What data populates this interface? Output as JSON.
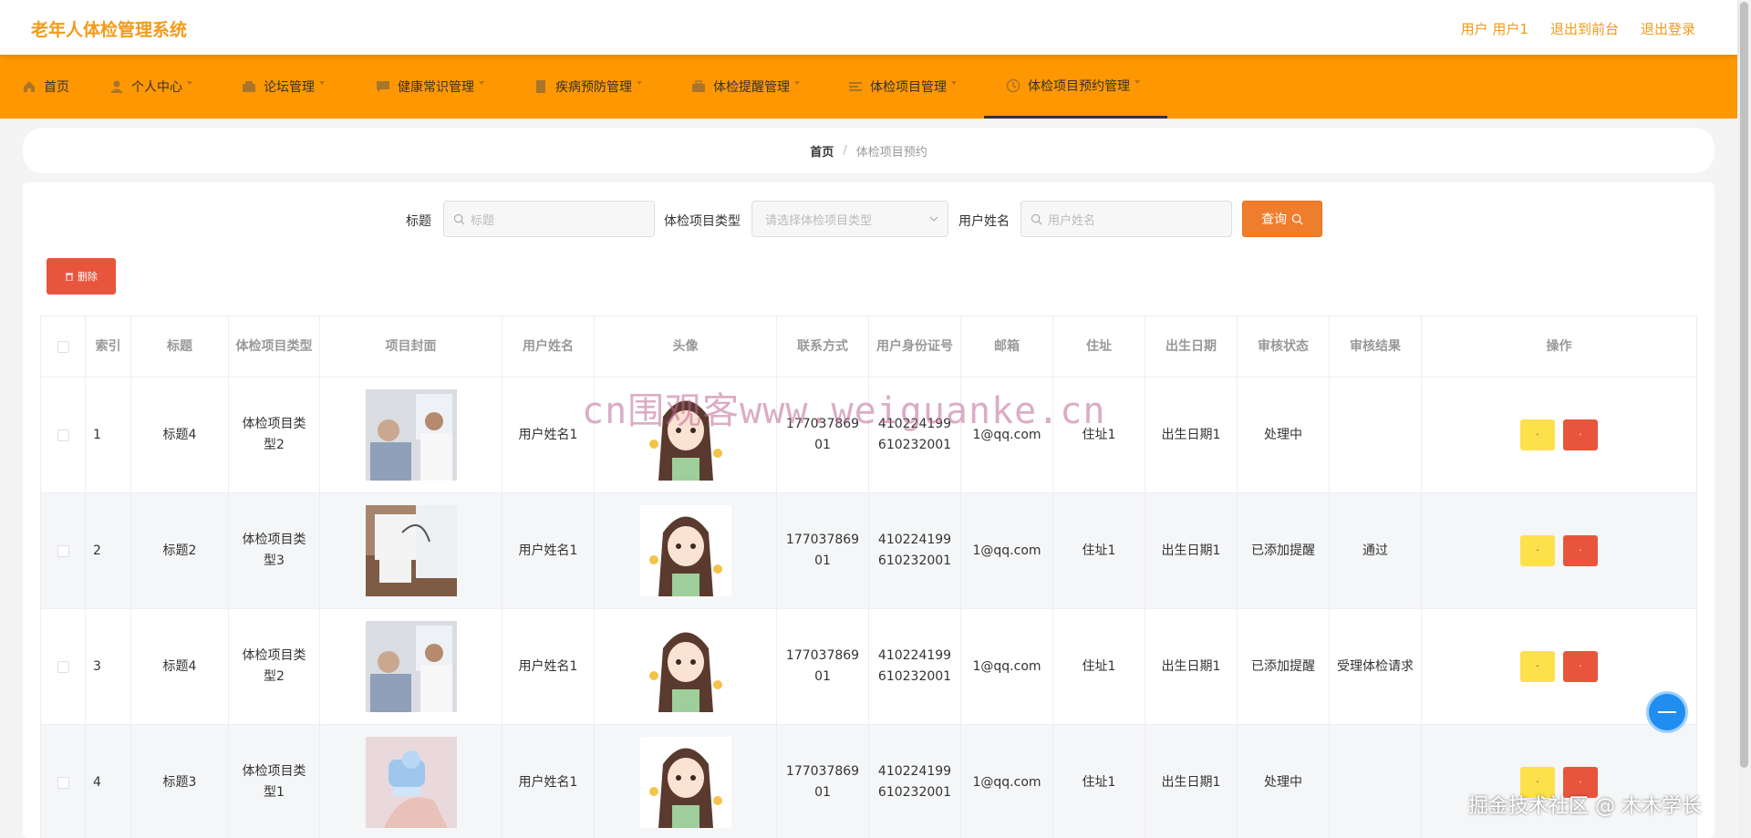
{
  "header": {
    "app_title": "老年人体检管理系统",
    "links": [
      "用户 用户1",
      "退出到前台",
      "退出登录"
    ]
  },
  "nav": {
    "items": [
      {
        "label": "首页",
        "icon": "home-icon"
      },
      {
        "label": "个人中心",
        "icon": "user-icon"
      },
      {
        "label": "论坛管理",
        "icon": "forum-icon"
      },
      {
        "label": "健康常识管理",
        "icon": "chat-icon"
      },
      {
        "label": "疾病预防管理",
        "icon": "document-icon"
      },
      {
        "label": "体检提醒管理",
        "icon": "briefcase-icon"
      },
      {
        "label": "体检项目管理",
        "icon": "list-icon"
      },
      {
        "label": "体检项目预约管理",
        "icon": "clock-icon"
      }
    ],
    "active_index": 7
  },
  "breadcrumb": {
    "home": "首页",
    "separator": "/",
    "current": "体检项目预约"
  },
  "search": {
    "title_label": "标题",
    "title_placeholder": "标题",
    "type_label": "体检项目类型",
    "type_placeholder": "请选择体检项目类型",
    "name_label": "用户姓名",
    "name_placeholder": "用户姓名",
    "query_button": "查询"
  },
  "actions": {
    "delete_button": "删除"
  },
  "table": {
    "headers": [
      "索引",
      "标题",
      "体检项目类型",
      "项目封面",
      "用户姓名",
      "头像",
      "联系方式",
      "用户身份证号",
      "邮箱",
      "住址",
      "出生日期",
      "审核状态",
      "审核结果",
      "操作"
    ],
    "rows": [
      {
        "index": "1",
        "title": "标题4",
        "type": "体检项目类型2",
        "name": "用户姓名1",
        "phone": "17703786901",
        "id_card": "410224199610232001",
        "email": "1@qq.com",
        "address": "住址1",
        "birth": "出生日期1",
        "status": "处理中",
        "result": "",
        "edit": "·",
        "remove": "·"
      },
      {
        "index": "2",
        "title": "标题2",
        "type": "体检项目类型3",
        "name": "用户姓名1",
        "phone": "17703786901",
        "id_card": "410224199610232001",
        "email": "1@qq.com",
        "address": "住址1",
        "birth": "出生日期1",
        "status": "已添加提醒",
        "result": "通过",
        "edit": "·",
        "remove": "·"
      },
      {
        "index": "3",
        "title": "标题4",
        "type": "体检项目类型2",
        "name": "用户姓名1",
        "phone": "17703786901",
        "id_card": "410224199610232001",
        "email": "1@qq.com",
        "address": "住址1",
        "birth": "出生日期1",
        "status": "已添加提醒",
        "result": "受理体检请求",
        "edit": "·",
        "remove": "·"
      },
      {
        "index": "4",
        "title": "标题3",
        "type": "体检项目类型1",
        "name": "用户姓名1",
        "phone": "17703786901",
        "id_card": "410224199610232001",
        "email": "1@qq.com",
        "address": "住址1",
        "birth": "出生日期1",
        "status": "处理中",
        "result": "",
        "edit": "·",
        "remove": "·"
      }
    ]
  },
  "overlay": {
    "watermark": "cn围观客www.weiguanke.cn",
    "credit": "掘金技术社区 @ 木木学长"
  },
  "colors": {
    "brand": "#fe9702",
    "title": "#f39a1a",
    "query": "#ef7d2e",
    "danger": "#e8553c",
    "warning": "#fde14b"
  }
}
